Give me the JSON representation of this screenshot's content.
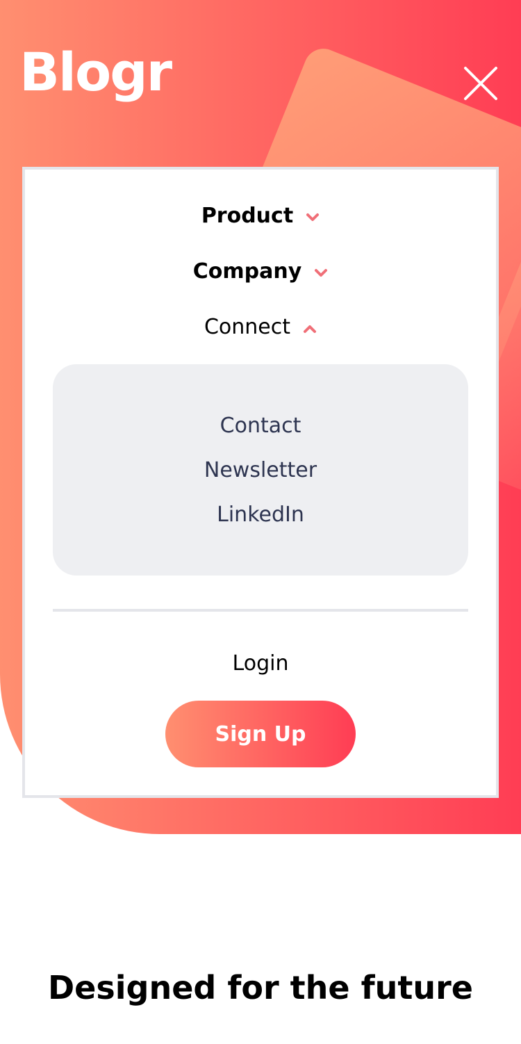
{
  "header": {
    "logo_text": "Blogr",
    "close_icon": "close-icon"
  },
  "nav": {
    "items": [
      {
        "label": "Product",
        "state": "collapsed",
        "icon": "chevron-down-icon"
      },
      {
        "label": "Company",
        "state": "collapsed",
        "icon": "chevron-down-icon"
      },
      {
        "label": "Connect",
        "state": "expanded",
        "icon": "chevron-up-icon"
      }
    ],
    "submenu": [
      "Contact",
      "Newsletter",
      "LinkedIn"
    ]
  },
  "auth": {
    "login_label": "Login",
    "signup_label": "Sign Up"
  },
  "main": {
    "headline": "Designed for the future"
  },
  "colors": {
    "gradient_start": "#ff8f70",
    "gradient_end": "#ff3d54",
    "chevron": "#f06f78",
    "submenu_bg": "#eeeff2",
    "submenu_text": "#2d3450"
  }
}
